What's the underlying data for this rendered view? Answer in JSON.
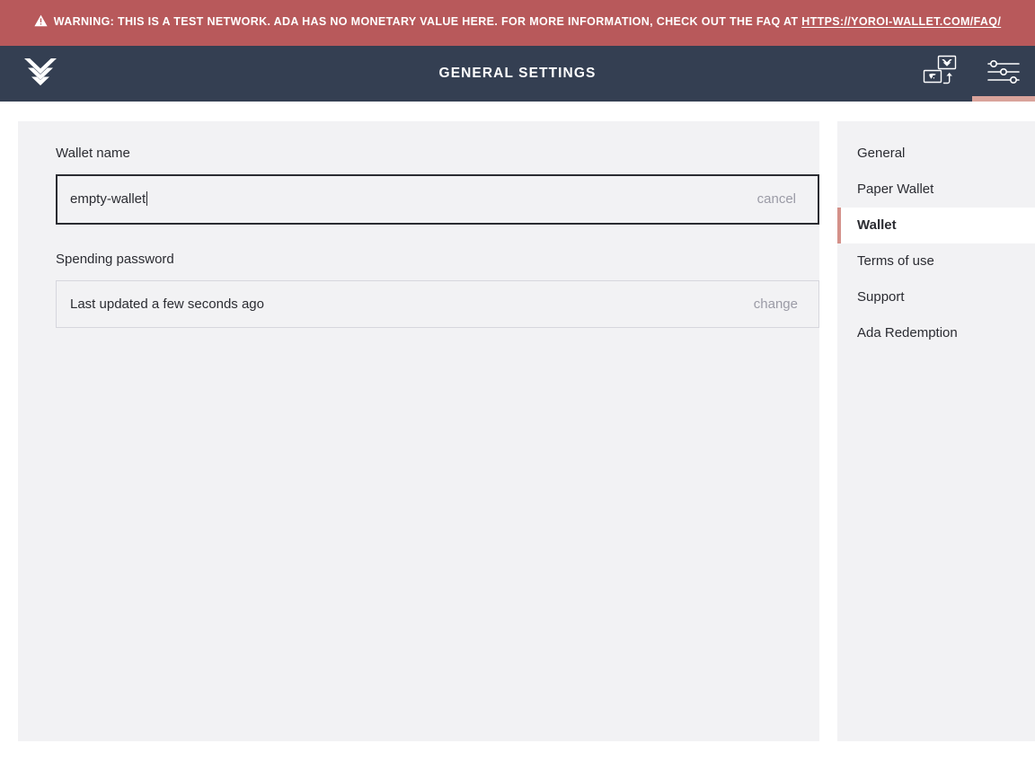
{
  "warning": {
    "icon": "warning-triangle-icon",
    "text_before_link": "WARNING: THIS IS A TEST NETWORK. ADA HAS NO MONETARY VALUE HERE. FOR MORE INFORMATION, CHECK OUT THE FAQ AT ",
    "link_text": "HTTPS://YOROI-WALLET.COM/FAQ/",
    "background_color": "#b8595b",
    "text_color": "#ffffff"
  },
  "topbar": {
    "logo_name": "yoroi-logo",
    "title": "GENERAL SETTINGS",
    "background_color": "#343f52",
    "actions": [
      {
        "name": "wallet-switch-icon",
        "label": "Switch wallet",
        "active": false
      },
      {
        "name": "settings-sliders-icon",
        "label": "Settings",
        "active": true
      }
    ],
    "active_indicator_color": "#d9a39b"
  },
  "main": {
    "panel_background": "#f2f2f4",
    "wallet_name": {
      "label": "Wallet name",
      "value": "empty-wallet",
      "placeholder": "Wallet name",
      "action_label": "cancel",
      "focused": true
    },
    "spending_password": {
      "label": "Spending password",
      "status_text": "Last updated a few seconds ago",
      "action_label": "change"
    }
  },
  "settings_menu": {
    "active_accent_color": "#d4918a",
    "items": [
      {
        "label": "General",
        "active": false
      },
      {
        "label": "Paper Wallet",
        "active": false
      },
      {
        "label": "Wallet",
        "active": true
      },
      {
        "label": "Terms of use",
        "active": false
      },
      {
        "label": "Support",
        "active": false
      },
      {
        "label": "Ada Redemption",
        "active": false
      }
    ]
  }
}
